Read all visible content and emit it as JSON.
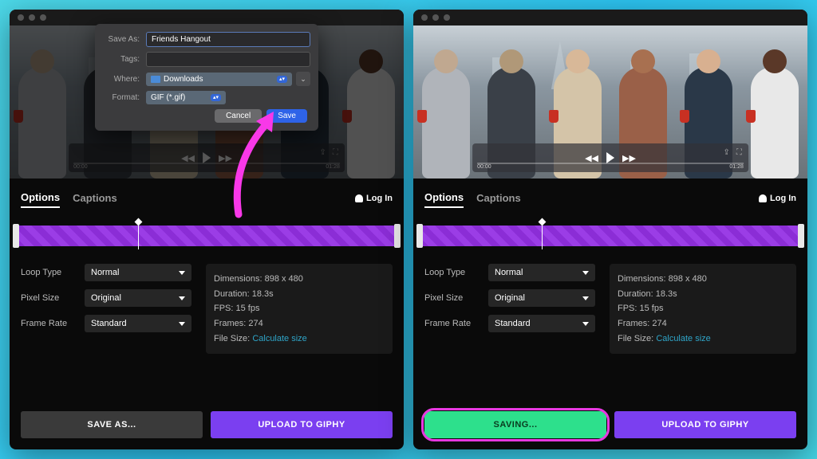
{
  "dialog": {
    "save_as_label": "Save As:",
    "save_as_value": "Friends Hangout",
    "tags_label": "Tags:",
    "where_label": "Where:",
    "where_value": "Downloads",
    "format_label": "Format:",
    "format_value": "GIF (*.gif)",
    "cancel": "Cancel",
    "save": "Save"
  },
  "player": {
    "time_start": "00:00",
    "time_end": "01:28"
  },
  "tabs": {
    "options": "Options",
    "captions": "Captions",
    "login": "Log In"
  },
  "options": {
    "loop_label": "Loop Type",
    "loop_value": "Normal",
    "pixel_label": "Pixel Size",
    "pixel_value": "Original",
    "frame_label": "Frame Rate",
    "frame_value": "Standard"
  },
  "info": {
    "dimensions_label": "Dimensions:",
    "dimensions_value": "898 x 480",
    "duration_label": "Duration:",
    "duration_value": "18.3s",
    "fps_label": "FPS:",
    "fps_value": "15 fps",
    "frames_label": "Frames:",
    "frames_value": "274",
    "filesize_label": "File Size:",
    "calculate": "Calculate size"
  },
  "actions": {
    "save_as": "SAVE AS...",
    "saving": "SAVING...",
    "upload": "UPLOAD TO GIPHY"
  }
}
